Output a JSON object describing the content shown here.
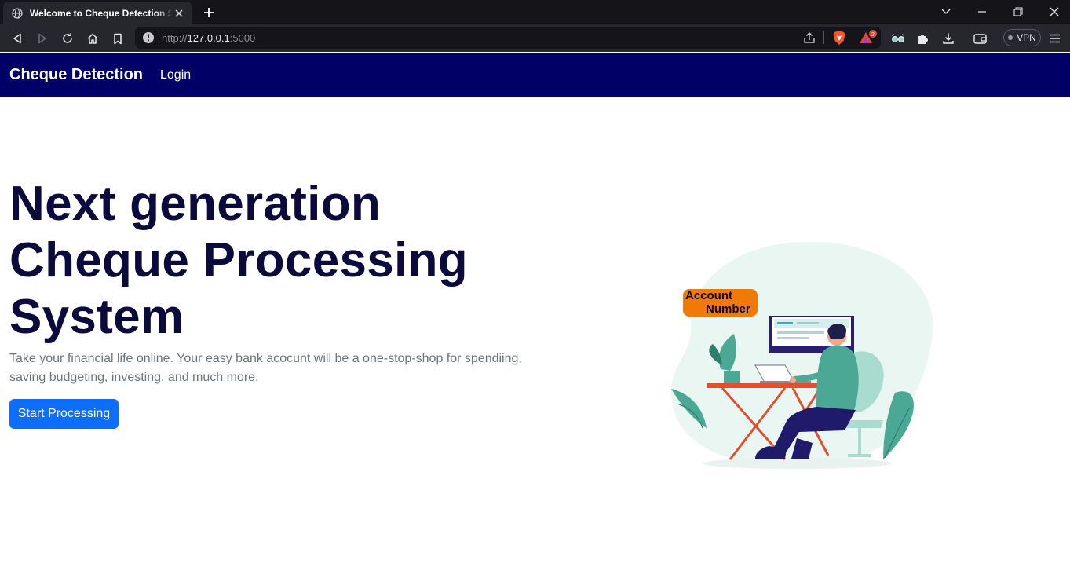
{
  "browser": {
    "tab_title": "Welcome to Cheque Detection System",
    "url_scheme": "http://",
    "url_host": "127.0.0.1",
    "url_port": ":5000",
    "rewards_count": "2",
    "vpn_label": "VPN",
    "icons": [
      "globe-icon",
      "close-icon",
      "plus-icon",
      "chevron-down-icon",
      "minimize-icon",
      "restore-icon",
      "back-icon",
      "forward-icon",
      "reload-icon",
      "home-icon",
      "bookmark-icon",
      "info-icon",
      "share-icon",
      "brave-shield-icon",
      "brave-rewards-icon",
      "extension-icon",
      "puzzle-icon",
      "download-icon",
      "wallet-icon",
      "menu-icon"
    ]
  },
  "navbar": {
    "brand": "Cheque Detection",
    "login": "Login",
    "background": "#000066"
  },
  "hero": {
    "title": "Next generation Cheque Processing System",
    "subtitle": "Take your financial life online. Your easy bank acocunt will be a one-stop-shop for spendiing, saving budgeting, investing, and much more.",
    "cta": "Start Processing",
    "cta_color": "#0d6efd"
  },
  "illustration": {
    "badge_line1": "Account",
    "badge_line2": "Number",
    "badge_color": "#f07a08"
  }
}
